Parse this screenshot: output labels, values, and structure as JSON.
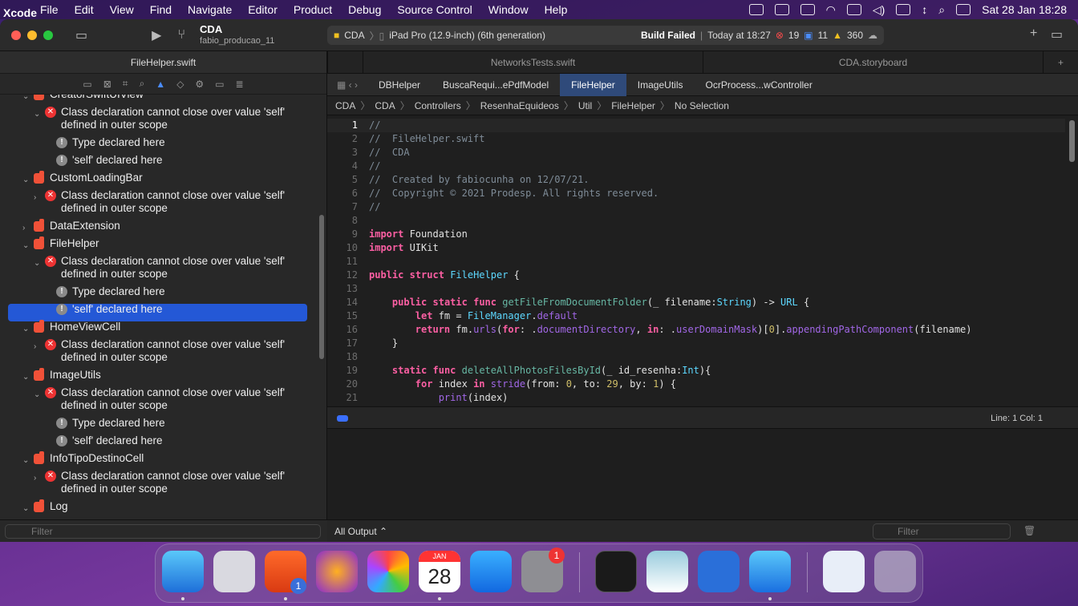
{
  "menubar": {
    "app": "Xcode",
    "items": [
      "File",
      "Edit",
      "View",
      "Find",
      "Navigate",
      "Editor",
      "Product",
      "Debug",
      "Source Control",
      "Window",
      "Help"
    ],
    "clock": "Sat 28 Jan  18:28"
  },
  "toolbar": {
    "project": "CDA",
    "branch": "fabio_producao_11",
    "scheme": "CDA",
    "destination": "iPad Pro (12.9-inch) (6th generation)",
    "build_status": "Build Failed",
    "build_time": "Today at 18:27",
    "errors": "19",
    "warnings": "11",
    "notes": "360"
  },
  "navigator": {
    "title": "FileHelper.swift",
    "filter_placeholder": "Filter",
    "rows": [
      {
        "kind": "file",
        "text": "CreatorSwiftUIView"
      },
      {
        "kind": "err",
        "text": "Class declaration cannot close over value 'self'",
        "text2": "defined in outer scope"
      },
      {
        "kind": "note",
        "text": "Type declared here"
      },
      {
        "kind": "note",
        "text": "'self' declared here"
      },
      {
        "kind": "file",
        "text": "CustomLoadingBar"
      },
      {
        "kind": "err",
        "text": "Class declaration cannot close over value 'self'",
        "text2": "defined in outer scope"
      },
      {
        "kind": "file",
        "text": "DataExtension"
      },
      {
        "kind": "file",
        "text": "FileHelper"
      },
      {
        "kind": "err",
        "text": "Class declaration cannot close over value 'self'",
        "text2": "defined in outer scope"
      },
      {
        "kind": "note",
        "text": "Type declared here"
      },
      {
        "kind": "note",
        "text": "'self' declared here"
      },
      {
        "kind": "file",
        "text": "HomeViewCell"
      },
      {
        "kind": "err",
        "text": "Class declaration cannot close over value 'self'",
        "text2": "defined in outer scope"
      },
      {
        "kind": "file",
        "text": "ImageUtils"
      },
      {
        "kind": "err",
        "text": "Class declaration cannot close over value 'self'",
        "text2": "defined in outer scope"
      },
      {
        "kind": "note",
        "text": "Type declared here"
      },
      {
        "kind": "note",
        "text": "'self' declared here"
      },
      {
        "kind": "file",
        "text": "InfoTipoDestinoCell"
      },
      {
        "kind": "err",
        "text": "Class declaration cannot close over value 'self'",
        "text2": "defined in outer scope"
      },
      {
        "kind": "file",
        "text": "Log"
      }
    ]
  },
  "editor": {
    "tabs": [
      "NetworksTests.swift",
      "CDA.storyboard"
    ],
    "jump_tabs": [
      "DBHelper",
      "BuscaRequi...ePdfModel",
      "FileHelper",
      "ImageUtils",
      "OcrProcess...wController"
    ],
    "crumbs": [
      "CDA",
      "CDA",
      "Controllers",
      "ResenhaEquideos",
      "Util",
      "FileHelper",
      "No Selection"
    ],
    "line_col": "Line: 1  Col: 1",
    "code": [
      "//",
      "//  FileHelper.swift",
      "//  CDA",
      "//",
      "//  Created by fabiocunha on 12/07/21.",
      "//  Copyright © 2021 Prodesp. All rights reserved.",
      "//",
      "",
      "import Foundation",
      "import UIKit",
      "",
      "public struct FileHelper {",
      "",
      "    public static func getFileFromDocumentFolder(_ filename:String) -> URL {",
      "        let fm = FileManager.default",
      "        return fm.urls(for: .documentDirectory, in: .userDomainMask)[0].appendingPathComponent(filename)",
      "    }",
      "",
      "    static func deleteAllPhotosFilesById(_ id_resenha:Int){",
      "        for index in stride(from: 0, to: 29, by: 1) {",
      "            print(index)"
    ]
  },
  "console": {
    "output_label": "All Output ⌃",
    "filter_placeholder": "Filter"
  },
  "dock": {
    "calendar_month": "JAN",
    "calendar_day": "28",
    "badges": {
      "brave": "1",
      "settings": "1"
    }
  },
  "colors": {
    "accent": "#2458d6",
    "error": "#e33333",
    "swift": "#f05138"
  }
}
